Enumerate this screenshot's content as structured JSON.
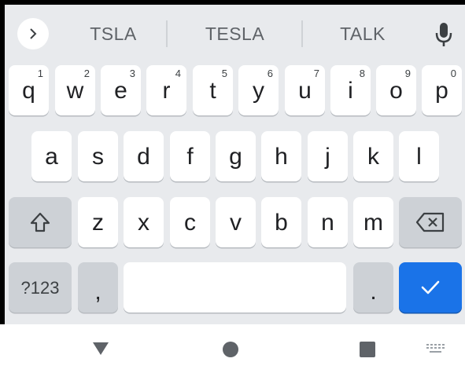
{
  "suggestions": [
    "TSLA",
    "TESLA",
    "TALK"
  ],
  "rows": {
    "row1": [
      {
        "char": "q",
        "hint": "1"
      },
      {
        "char": "w",
        "hint": "2"
      },
      {
        "char": "e",
        "hint": "3"
      },
      {
        "char": "r",
        "hint": "4"
      },
      {
        "char": "t",
        "hint": "5"
      },
      {
        "char": "y",
        "hint": "6"
      },
      {
        "char": "u",
        "hint": "7"
      },
      {
        "char": "i",
        "hint": "8"
      },
      {
        "char": "o",
        "hint": "9"
      },
      {
        "char": "p",
        "hint": "0"
      }
    ],
    "row2": [
      "a",
      "s",
      "d",
      "f",
      "g",
      "h",
      "j",
      "k",
      "l"
    ],
    "row3": [
      "z",
      "x",
      "c",
      "v",
      "b",
      "n",
      "m"
    ]
  },
  "keys": {
    "symbols_label": "?123",
    "comma_label": ",",
    "period_label": "."
  },
  "icons": {
    "expand": "chevron-right-icon",
    "mic": "microphone-icon",
    "shift": "shift-icon",
    "backspace": "backspace-icon",
    "enter": "checkmark-icon",
    "nav_back": "triangle-down-icon",
    "nav_home": "circle-icon",
    "nav_recents": "square-icon",
    "nav_keyboard": "keyboard-icon"
  },
  "colors": {
    "keyboard_bg": "#e8eaed",
    "key_bg": "#ffffff",
    "function_key_bg": "#cdd1d6",
    "enter_key_bg": "#1a73e8",
    "text": "#202124",
    "suggestion_text": "#5f6368"
  }
}
